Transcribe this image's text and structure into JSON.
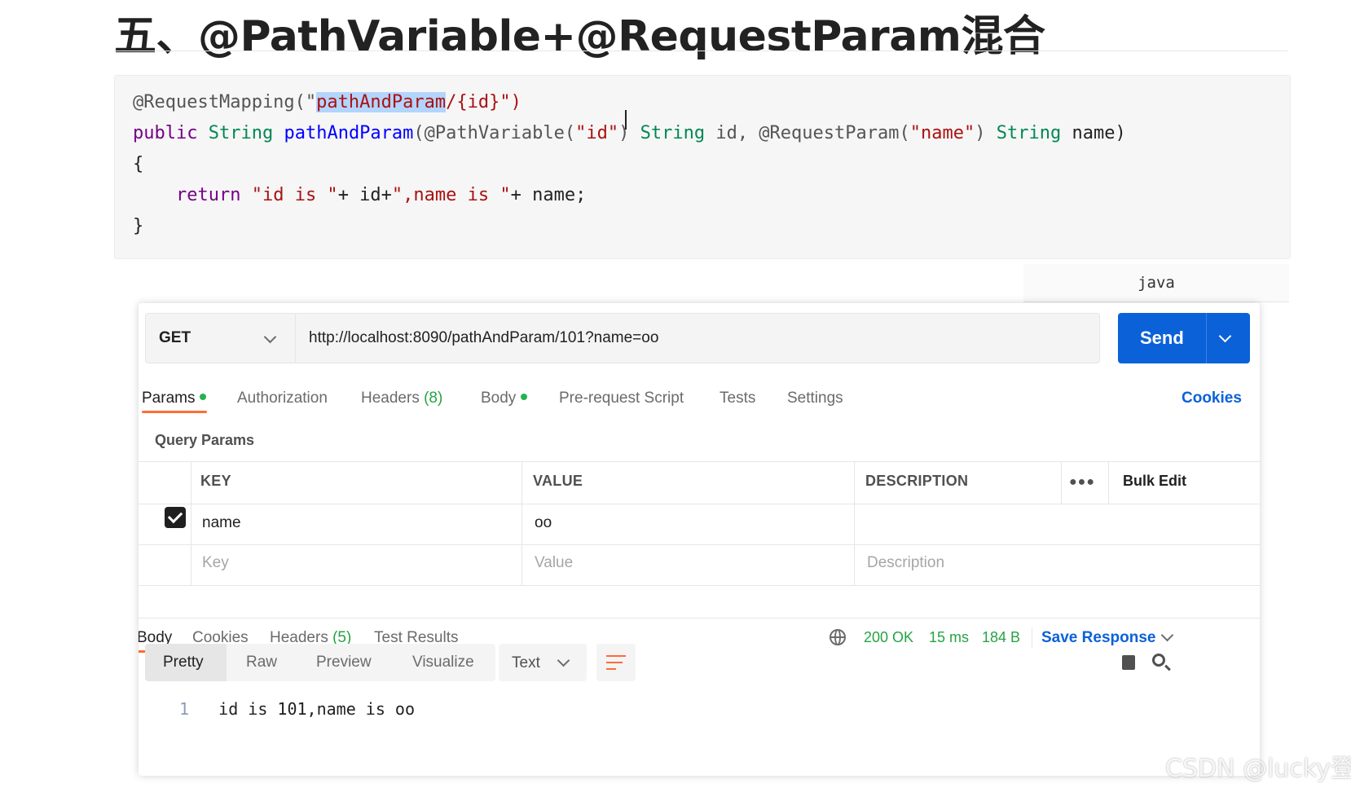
{
  "heading": "五、@PathVariable+@RequestParam混合",
  "code": {
    "line1": {
      "a": "@RequestMapping(\"",
      "sel": "pathAndParam",
      "b": "/{id}\")"
    },
    "line2": {
      "kw": "public",
      "ty1": "String",
      "fn": "pathAndParam",
      "p1": "(@PathVariable(",
      "s1": "\"id\"",
      "p2": ") ",
      "ty2": "String",
      "p3": " id, @RequestParam(",
      "s2": "\"name\"",
      "p4": ") ",
      "ty3": "String",
      "p5": " name)"
    },
    "line3": "{",
    "line4": {
      "kw": "return",
      "s1": "\"id is \"",
      "p1": "+ id+",
      "s2": "\",name is \"",
      "p2": "+ name;"
    },
    "line5": "}",
    "language": "java"
  },
  "request": {
    "method": "GET",
    "url": "http://localhost:8090/pathAndParam/101?name=oo",
    "send_label": "Send"
  },
  "request_tabs": {
    "params": "Params",
    "authorization": "Authorization",
    "headers": "Headers",
    "headers_count": "(8)",
    "body": "Body",
    "pre_request": "Pre-request Script",
    "tests": "Tests",
    "settings": "Settings",
    "cookies": "Cookies"
  },
  "query_params": {
    "label": "Query Params",
    "columns": {
      "key": "KEY",
      "value": "VALUE",
      "description": "DESCRIPTION"
    },
    "bulk_edit": "Bulk Edit",
    "rows": [
      {
        "key": "name",
        "value": "oo",
        "checked": true
      }
    ],
    "placeholders": {
      "key": "Key",
      "value": "Value",
      "description": "Description"
    }
  },
  "response": {
    "tabs": {
      "body": "Body",
      "cookies": "Cookies",
      "headers": "Headers",
      "headers_count": "(5)",
      "test_results": "Test Results"
    },
    "status": "200 OK",
    "time": "15 ms",
    "size": "184 B",
    "save_response": "Save Response",
    "views": {
      "pretty": "Pretty",
      "raw": "Raw",
      "preview": "Preview",
      "visualize": "Visualize"
    },
    "format": "Text",
    "lines": [
      {
        "num": "1",
        "text": "id is 101,name is oo"
      }
    ]
  },
  "colors": {
    "accent": "#0b61d8",
    "tab_indicator": "#ff6c37",
    "success": "#26a344"
  },
  "watermark": "CSDN @lucky登"
}
